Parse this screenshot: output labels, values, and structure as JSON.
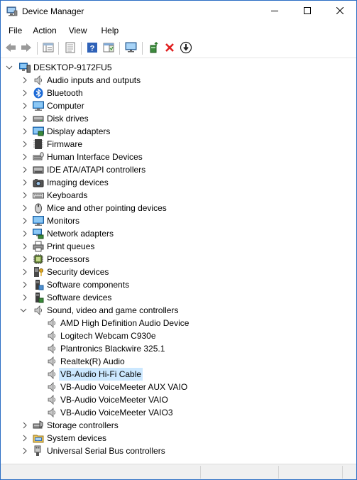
{
  "window": {
    "title": "Device Manager",
    "icon": "device-manager-icon"
  },
  "menu": [
    {
      "label": "File"
    },
    {
      "label": "Action"
    },
    {
      "label": "View"
    },
    {
      "label": "Help"
    }
  ],
  "toolbar": {
    "buttons": [
      "back-arrow-icon",
      "forward-arrow-icon",
      "properties-view-icon",
      "list-view-icon",
      "help-icon",
      "action-pane-icon",
      "monitor-scan-icon",
      "update-driver-icon",
      "uninstall-icon",
      "download-driver-icon"
    ]
  },
  "tree": {
    "root": "DESKTOP-9172FU5",
    "categories": [
      {
        "label": "Audio inputs and outputs",
        "icon": "speaker-icon"
      },
      {
        "label": "Bluetooth",
        "icon": "bluetooth-icon"
      },
      {
        "label": "Computer",
        "icon": "computer-icon"
      },
      {
        "label": "Disk drives",
        "icon": "disk-drive-icon"
      },
      {
        "label": "Display adapters",
        "icon": "display-adapter-icon"
      },
      {
        "label": "Firmware",
        "icon": "firmware-icon"
      },
      {
        "label": "Human Interface Devices",
        "icon": "hid-icon"
      },
      {
        "label": "IDE ATA/ATAPI controllers",
        "icon": "ide-controller-icon"
      },
      {
        "label": "Imaging devices",
        "icon": "camera-icon"
      },
      {
        "label": "Keyboards",
        "icon": "keyboard-icon"
      },
      {
        "label": "Mice and other pointing devices",
        "icon": "mouse-icon"
      },
      {
        "label": "Monitors",
        "icon": "monitor-icon"
      },
      {
        "label": "Network adapters",
        "icon": "network-adapter-icon"
      },
      {
        "label": "Print queues",
        "icon": "printer-icon"
      },
      {
        "label": "Processors",
        "icon": "processor-icon"
      },
      {
        "label": "Security devices",
        "icon": "security-key-icon"
      },
      {
        "label": "Software components",
        "icon": "software-component-icon"
      },
      {
        "label": "Software devices",
        "icon": "software-device-icon"
      },
      {
        "label": "Sound, video and game controllers",
        "icon": "speaker-icon",
        "expanded": true
      }
    ],
    "sound_children": [
      {
        "label": "AMD High Definition Audio Device"
      },
      {
        "label": "Logitech Webcam C930e"
      },
      {
        "label": "Plantronics Blackwire 325.1"
      },
      {
        "label": "Realtek(R) Audio"
      },
      {
        "label": "VB-Audio Hi-Fi Cable",
        "selected": true
      },
      {
        "label": "VB-Audio VoiceMeeter AUX VAIO"
      },
      {
        "label": "VB-Audio VoiceMeeter VAIO"
      },
      {
        "label": "VB-Audio VoiceMeeter VAIO3"
      }
    ],
    "after": [
      {
        "label": "Storage controllers",
        "icon": "storage-controller-icon"
      },
      {
        "label": "System devices",
        "icon": "system-folder-icon"
      },
      {
        "label": "Universal Serial Bus controllers",
        "icon": "usb-icon"
      }
    ]
  },
  "colors": {
    "selection": "#cce8ff",
    "accent": "#2b6dc4"
  }
}
